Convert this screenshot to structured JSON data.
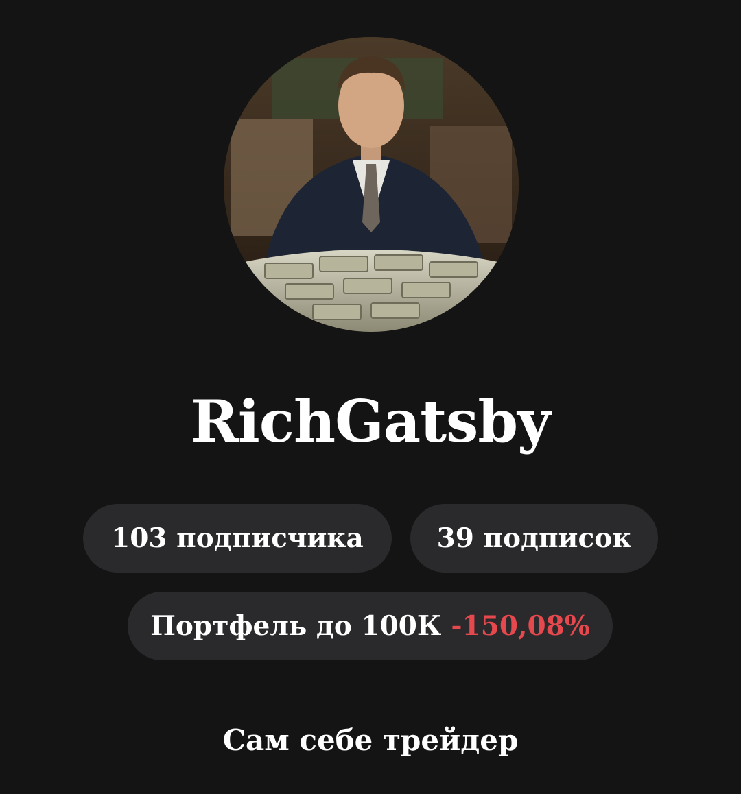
{
  "profile": {
    "avatar_icon": "profile-photo",
    "username": "RichGatsby",
    "followers_label": "103 подписчика",
    "following_label": "39 подписок",
    "portfolio_label": "Портфель до 100К",
    "portfolio_change": "-150,08%",
    "bio": "Сам себе трейдер"
  },
  "colors": {
    "background": "#141414",
    "pill": "#2a2a2c",
    "negative": "#e5484d",
    "text": "#ffffff"
  }
}
